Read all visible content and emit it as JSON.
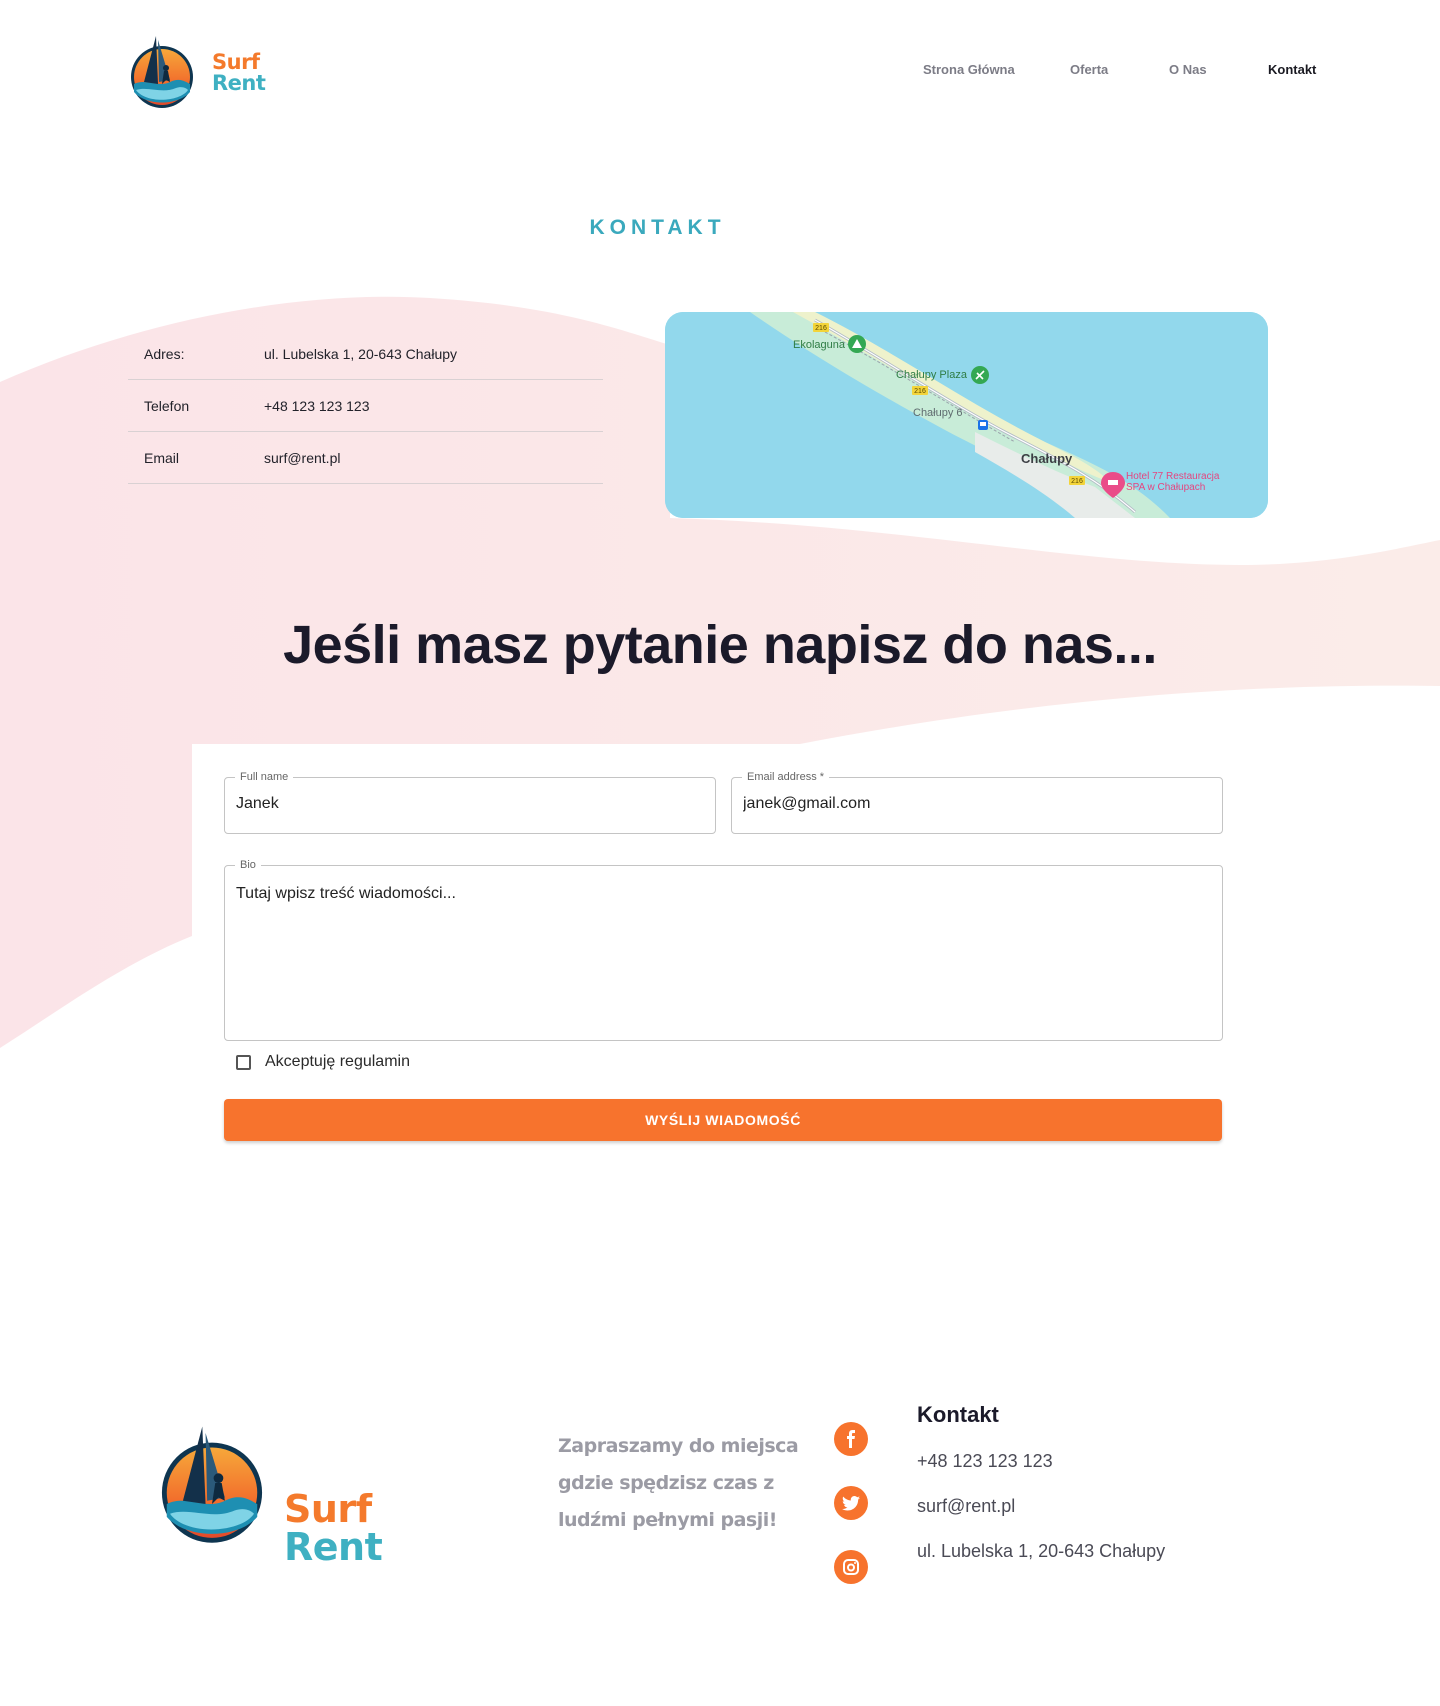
{
  "brand": {
    "name_line1": "Surf",
    "name_line2": "Rent"
  },
  "nav": {
    "items": [
      {
        "label": "Strona Główna",
        "active": false
      },
      {
        "label": "Oferta",
        "active": false
      },
      {
        "label": "O Nas",
        "active": false
      },
      {
        "label": "Kontakt",
        "active": true
      }
    ]
  },
  "contact_section": {
    "title": "KONTAKT",
    "rows": [
      {
        "label": "Adres:",
        "value": "ul. Lubelska 1, 20-643 Chałupy"
      },
      {
        "label": "Telefon",
        "value": "+48 123 123 123"
      },
      {
        "label": "Email",
        "value": "surf@rent.pl"
      }
    ]
  },
  "map": {
    "labels": {
      "ekolaguna": "Ekolaguna",
      "chalupy_plaza": "Chałupy Plaza",
      "chalupy_6": "Chałupy 6",
      "chalupy": "Chałupy",
      "hotel_line1": "Hotel 77 Restauracja",
      "hotel_line2": "SPA w Chałupach",
      "road_number": "216"
    }
  },
  "form_section": {
    "heading": "Jeśli masz pytanie napisz do nas...",
    "full_name": {
      "label": "Full name",
      "value": "Janek"
    },
    "email": {
      "label": "Email address *",
      "value": "janek@gmail.com"
    },
    "bio": {
      "label": "Bio",
      "value": "Tutaj wpisz treść wiadomości..."
    },
    "checkbox_label": "Akceptuję regulamin",
    "checkbox_checked": false,
    "submit_label": "WYŚLIJ WIADOMOŚĆ"
  },
  "footer": {
    "tagline": "Zapraszamy do miejsca gdzie spędzisz czas z ludźmi pełnymi pasji!",
    "social_icons": [
      "facebook-icon",
      "twitter-icon",
      "instagram-icon"
    ],
    "contact_title": "Kontakt",
    "phone": "+48 123 123 123",
    "email": "surf@rent.pl",
    "address": "ul. Lubelska 1, 20-643 Chałupy"
  },
  "colors": {
    "accent_orange": "#f7732d",
    "accent_teal": "#3aa9bd",
    "wave_pink": "#fbe4e6",
    "text_dark": "#1b1a2a"
  }
}
